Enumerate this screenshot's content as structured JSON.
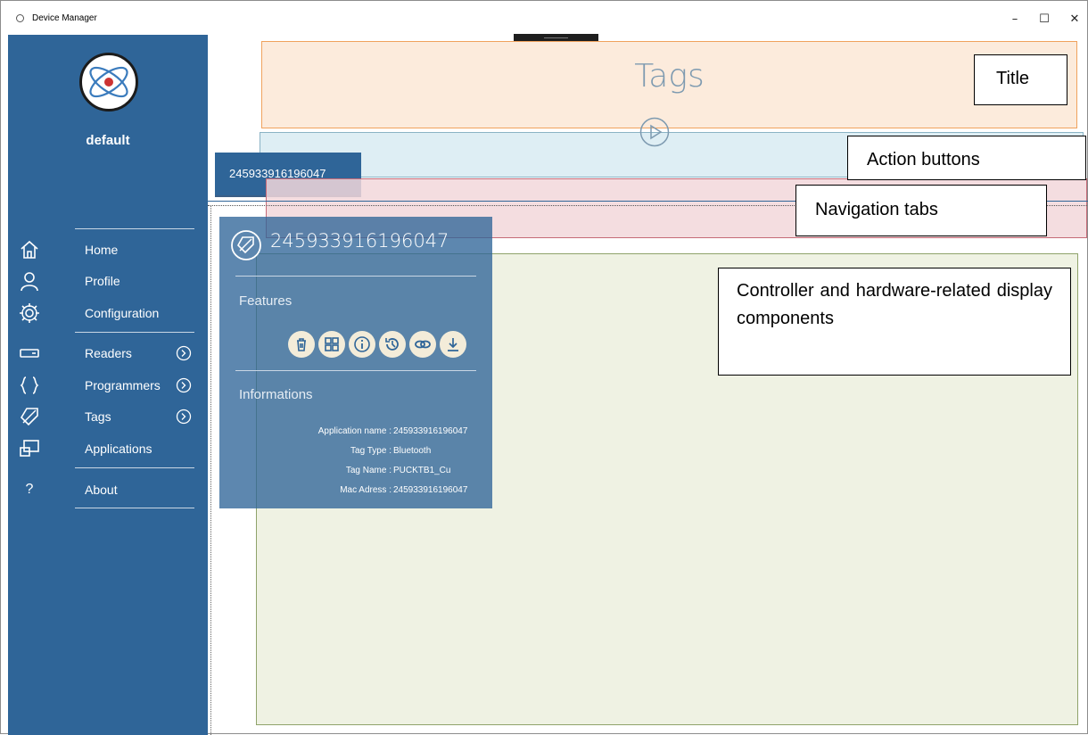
{
  "window": {
    "title": "Device Manager",
    "controls": {
      "minimize": "–",
      "maximize": "☐",
      "close": "✕"
    }
  },
  "sidebar": {
    "profile_name": "default",
    "items": [
      {
        "label": "Home",
        "icon": "home-icon"
      },
      {
        "label": "Profile",
        "icon": "person-icon"
      },
      {
        "label": "Configuration",
        "icon": "gear-icon"
      },
      {
        "label": "Readers",
        "icon": "reader-icon",
        "expandable": true
      },
      {
        "label": "Programmers",
        "icon": "braces-icon",
        "expandable": true
      },
      {
        "label": "Tags",
        "icon": "tag-icon",
        "expandable": true
      },
      {
        "label": "Applications",
        "icon": "cast-icon"
      },
      {
        "label": "About",
        "icon": "question-icon"
      }
    ]
  },
  "header": {
    "title": "Tags"
  },
  "tabs": [
    {
      "label": "245933916196047"
    }
  ],
  "tag_card": {
    "title": "245933916196047",
    "features_label": "Features",
    "feature_buttons": [
      "trash-icon",
      "grid-icon",
      "info-icon",
      "history-icon",
      "link-icon",
      "download-icon"
    ],
    "informations_label": "Informations",
    "info": [
      {
        "key": "Application name :",
        "value": "245933916196047"
      },
      {
        "key": "Tag Type :",
        "value": "Bluetooth"
      },
      {
        "key": "Tag Name :",
        "value": "PUCKTB1_Cu"
      },
      {
        "key": "Mac Adress :",
        "value": "245933916196047"
      }
    ]
  },
  "annotations": {
    "title": "Title",
    "action_buttons": "Action buttons",
    "navigation_tabs": "Navigation tabs",
    "controller": "Controller and hardware-related display components"
  },
  "colors": {
    "sidebar": "#2f6598",
    "title_region": "#fcebdc",
    "action_region": "#deeef4",
    "nav_region": "#f2d7da",
    "content_region": "#eff2e3"
  }
}
